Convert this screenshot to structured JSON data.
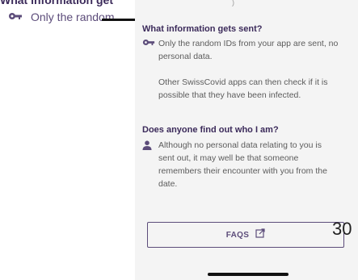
{
  "background_screen": {
    "heading": "What information get",
    "row_text": "Only the random"
  },
  "top_fragment": ")",
  "sections": [
    {
      "title": "What information gets sent?",
      "icon": "key-icon",
      "paragraphs": [
        "Only the random IDs from your app are sent, no personal data.",
        "Other SwissCovid apps can then check if it is possible that they have been infected."
      ]
    },
    {
      "title": "Does anyone find out who I am?",
      "icon": "person-icon",
      "paragraphs": [
        "Although no personal data relating to you is sent out, it may well be that someone remembers their encounter with you from the date."
      ]
    }
  ],
  "faq_button": {
    "label": "FAQS",
    "icon": "external-link-icon"
  },
  "overlay_number": "30",
  "colors": {
    "accent": "#5c4c7a",
    "title": "#3b2a5a",
    "sheet_bg": "#f4f4f4"
  }
}
